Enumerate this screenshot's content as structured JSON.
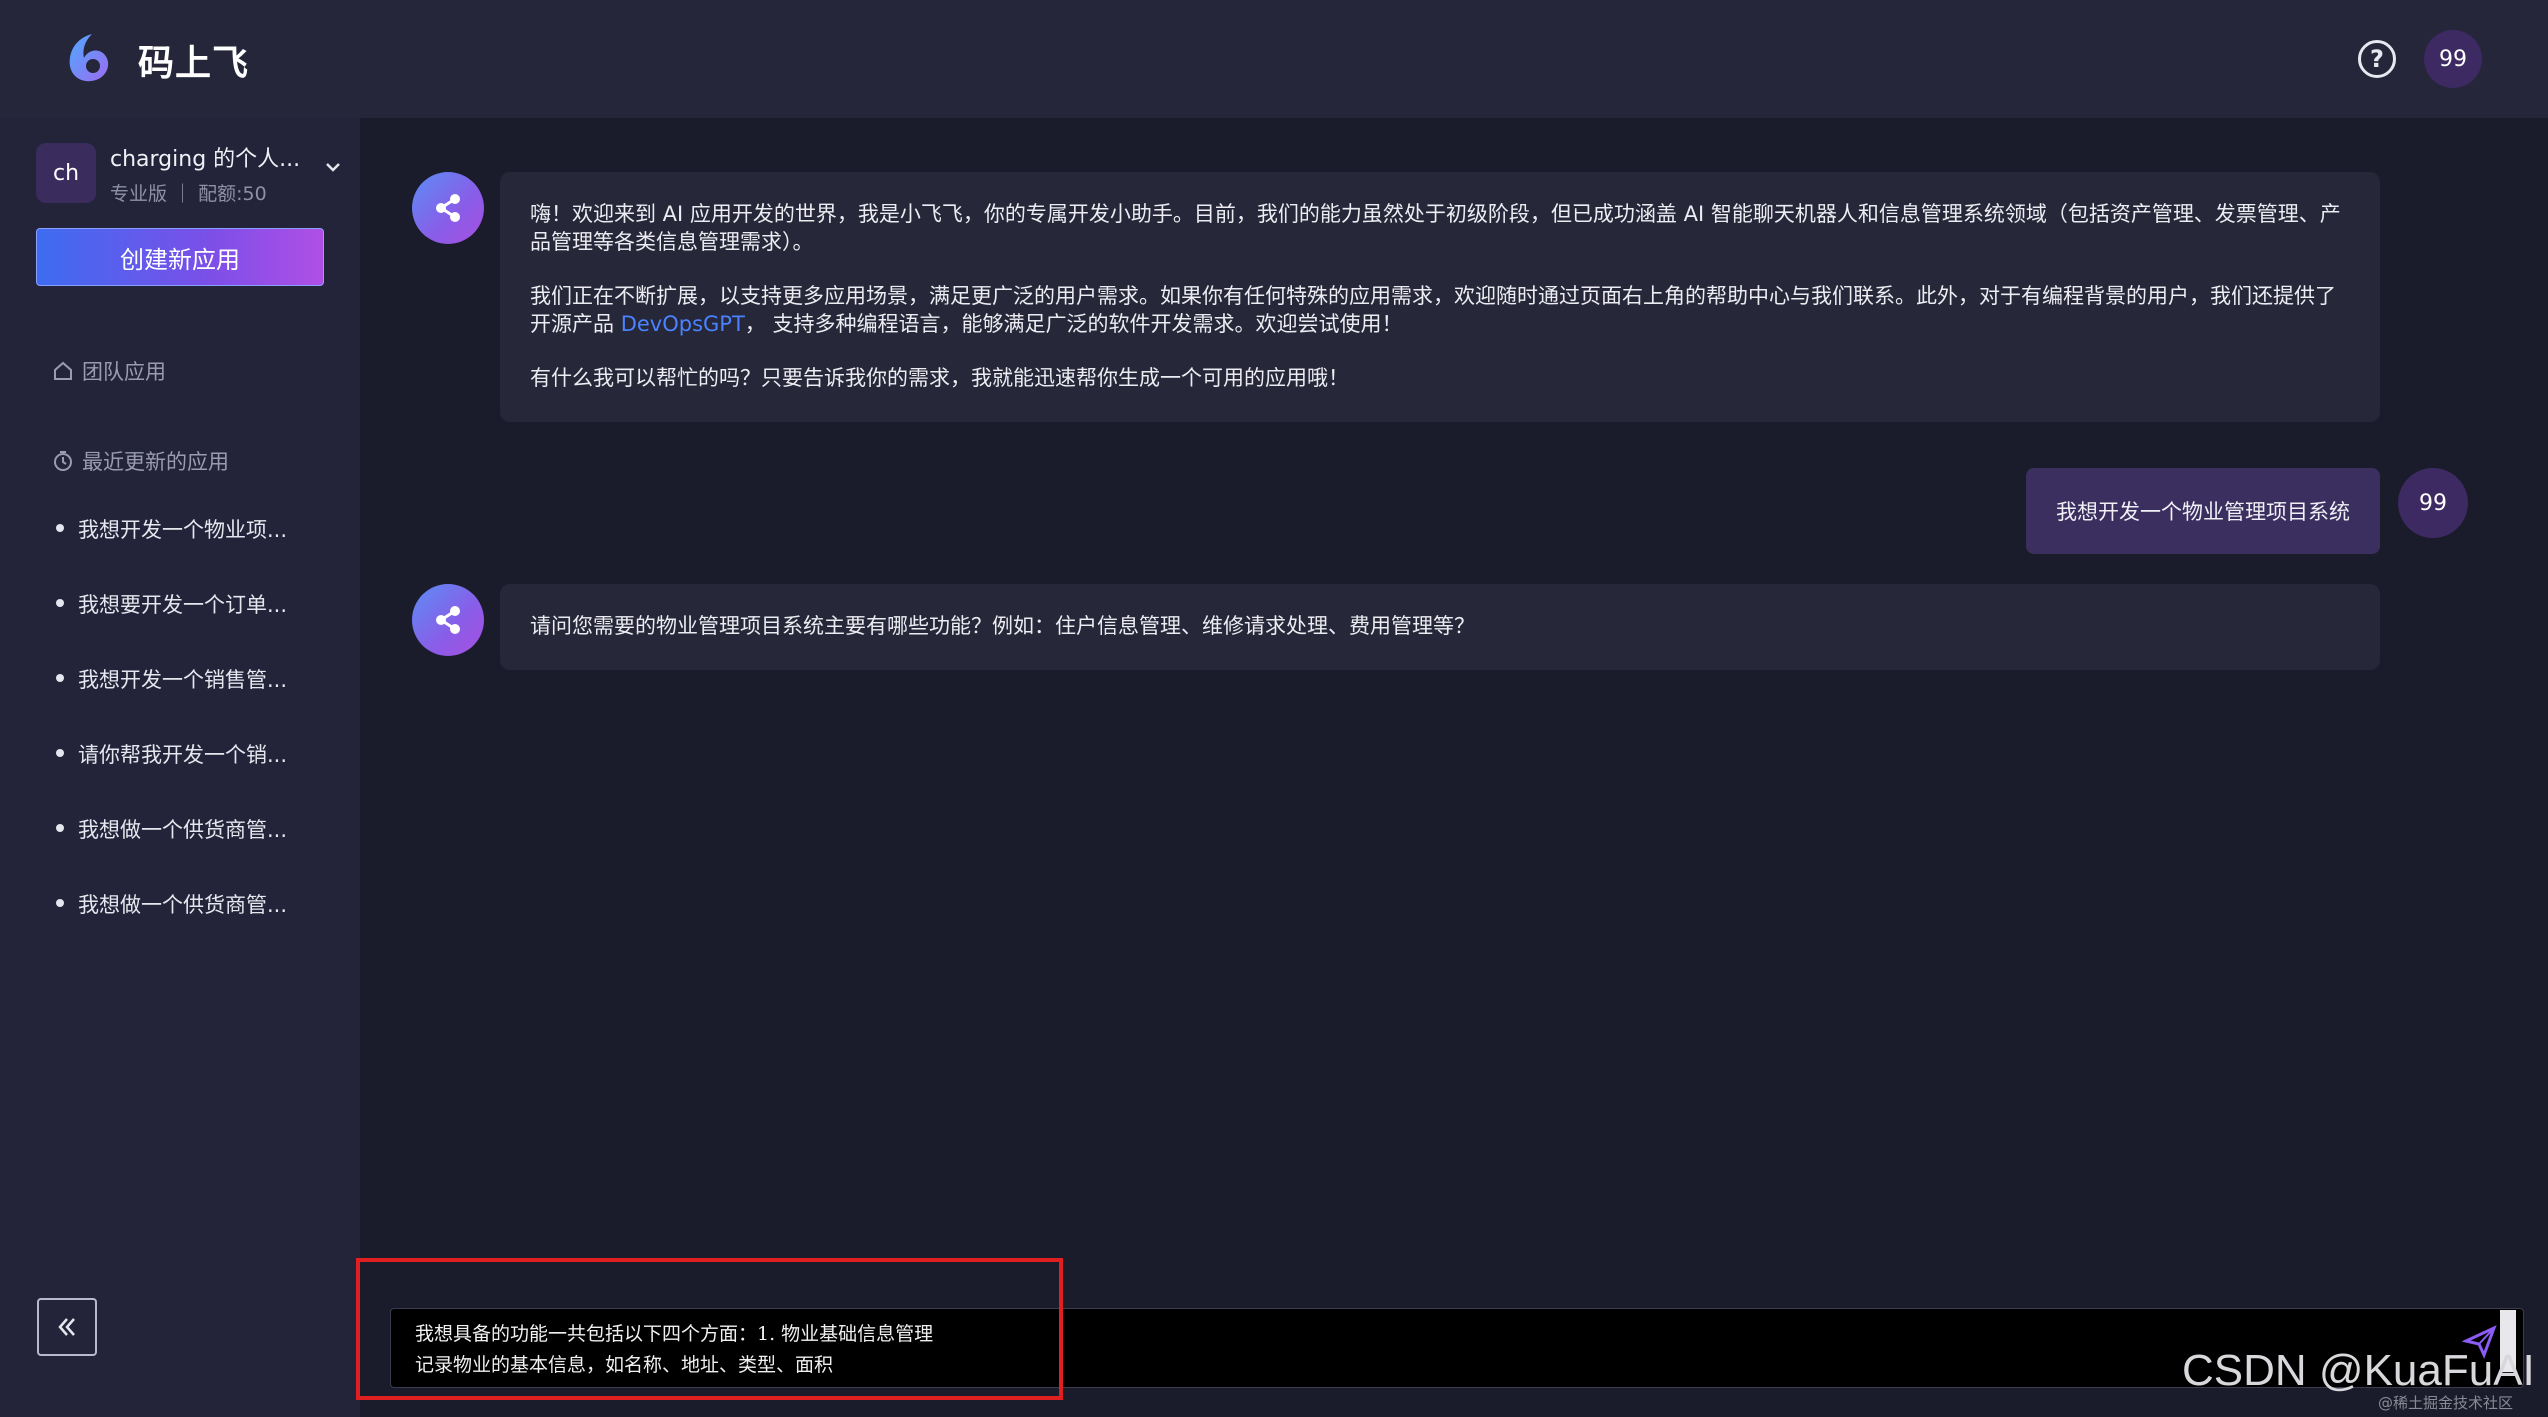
{
  "header": {
    "brand": "码上飞",
    "help_icon": "question-circle-icon",
    "user_avatar": "99"
  },
  "sidebar": {
    "account": {
      "avatar": "ch",
      "name": "charging 的个人...",
      "subtitle": "专业版 ｜ 配额:50"
    },
    "create_button": "创建新应用",
    "team_apps": "团队应用",
    "recent_apps": "最近更新的应用",
    "recent_items": [
      "我想开发一个物业项...",
      "我想要开发一个订单...",
      "我想开发一个销售管...",
      "请你帮我开发一个销...",
      "我想做一个供货商管...",
      "我想做一个供货商管..."
    ]
  },
  "chat": {
    "welcome": {
      "p1": "嗨！欢迎来到 AI 应用开发的世界，我是小飞飞，你的专属开发小助手。目前，我们的能力虽然处于初级阶段，但已成功涵盖 AI 智能聊天机器人和信息管理系统领域（包括资产管理、发票管理、产品管理等各类信息管理需求）。",
      "p2_before": "我们正在不断扩展，以支持更多应用场景，满足更广泛的用户需求。如果你有任何特殊的应用需求，欢迎随时通过页面右上角的帮助中心与我们联系。此外，对于有编程背景的用户，我们还提供了开源产品 ",
      "p2_link": "DevOpsGPT",
      "p2_after": "， 支持多种编程语言，能够满足广泛的软件开发需求。欢迎尝试使用！",
      "p3": "有什么我可以帮忙的吗？只要告诉我你的需求，我就能迅速帮你生成一个可用的应用哦！"
    },
    "user_message": "我想开发一个物业管理项目系统",
    "user_avatar": "99",
    "bot_reply": "请问您需要的物业管理项目系统主要有哪些功能？例如：住户信息管理、维修请求处理、费用管理等？"
  },
  "input": {
    "value": "我想具备的功能一共包括以下四个方面：1. 物业基础信息管理\n记录物业的基本信息，如名称、地址、类型、面积"
  },
  "watermark": {
    "main": "CSDN @KuaFuAI",
    "small": "@稀土掘金技术社区"
  },
  "colors": {
    "background": "#1b1c2b",
    "sidebar": "#23243a",
    "header": "#25263a",
    "bubble": "#262738",
    "user_bubble": "#3b2f5f",
    "link": "#4a82ff",
    "highlight": "#e02020"
  }
}
